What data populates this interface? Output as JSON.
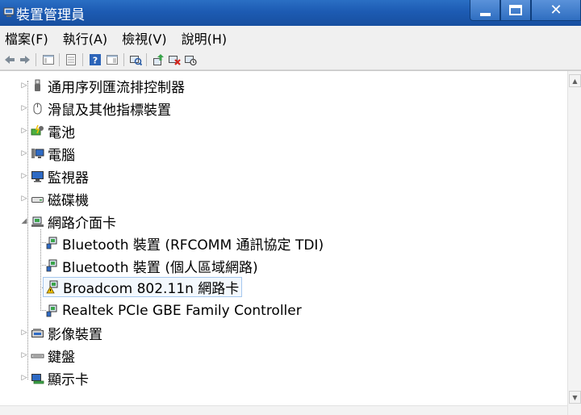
{
  "window": {
    "title": "裝置管理員",
    "minimize_glyph": "",
    "close_glyph": "✕"
  },
  "menu": {
    "items": [
      {
        "label": "檔案(F)"
      },
      {
        "label": "執行(A)"
      },
      {
        "label": "檢視(V)"
      },
      {
        "label": "說明(H)"
      }
    ]
  },
  "toolbar": {
    "icons": [
      "back-arrow-icon",
      "forward-arrow-icon",
      "show-hide-console-tree-icon",
      "properties-icon",
      "help-icon",
      "action-pane-icon",
      "scan-hardware-icon",
      "update-driver-icon",
      "uninstall-device-icon",
      "disable-device-icon"
    ]
  },
  "tree": {
    "categories": [
      {
        "label": "通用序列匯流排控制器",
        "icon": "usb-icon",
        "expanded": false
      },
      {
        "label": "滑鼠及其他指標裝置",
        "icon": "mouse-icon",
        "expanded": false
      },
      {
        "label": "電池",
        "icon": "battery-icon",
        "expanded": false
      },
      {
        "label": "電腦",
        "icon": "computer-icon",
        "expanded": false
      },
      {
        "label": "監視器",
        "icon": "monitor-icon",
        "expanded": false
      },
      {
        "label": "磁碟機",
        "icon": "disk-drive-icon",
        "expanded": false
      },
      {
        "label": "網路介面卡",
        "icon": "network-adapter-icon",
        "expanded": true
      }
    ],
    "network_children": [
      {
        "label": "Bluetooth 裝置 (RFCOMM 通訊協定 TDI)",
        "warning": false
      },
      {
        "label": "Bluetooth 裝置 (個人區域網路)",
        "warning": false
      },
      {
        "label": "Broadcom 802.11n 網路卡",
        "warning": true
      },
      {
        "label": "Realtek PCIe GBE Family Controller",
        "warning": false
      }
    ],
    "after": [
      {
        "label": "影像裝置",
        "icon": "imaging-device-icon",
        "expanded": false
      },
      {
        "label": "鍵盤",
        "icon": "keyboard-icon",
        "expanded": false
      },
      {
        "label": "顯示卡",
        "icon": "display-adapter-icon",
        "expanded": false
      }
    ],
    "collapsed_glyph": "▷",
    "expanded_glyph": "◢"
  },
  "colors": {
    "titlebar": "#1d5bb3",
    "selection_border": "#a6c8ee",
    "warning": "#f2c200"
  }
}
